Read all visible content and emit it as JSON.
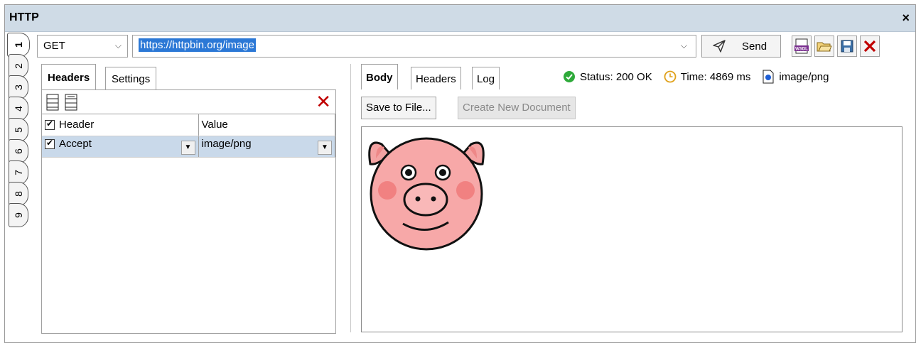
{
  "window": {
    "title": "HTTP",
    "close_label": "×"
  },
  "vertical_tabs": [
    "1",
    "2",
    "3",
    "4",
    "5",
    "6",
    "7",
    "8",
    "9"
  ],
  "request": {
    "method": "GET",
    "url": "https://httpbin.org/image",
    "send_label": "Send"
  },
  "left": {
    "tabs": [
      "Headers",
      "Settings"
    ],
    "table": {
      "columns": [
        "Header",
        "Value"
      ],
      "rows": [
        {
          "header": "Accept",
          "value": "image/png"
        }
      ]
    }
  },
  "right": {
    "tabs": [
      "Body",
      "Headers",
      "Log"
    ],
    "status": "Status: 200 OK",
    "time": "Time: 4869 ms",
    "content_type": "image/png",
    "save_label": "Save to File...",
    "create_label": "Create New Document"
  },
  "colors": {
    "accent": "#2b78d6",
    "titlebar": "#cfdbe6",
    "status_ok": "#2eaa3a",
    "delete": "#c00000"
  },
  "icons": {
    "send": "paper-plane-icon",
    "toolbar": [
      "wsdl-icon",
      "open-folder-icon",
      "save-icon",
      "close-red-icon"
    ],
    "status_ok": "check-circle-icon",
    "time": "clock-icon",
    "content_type": "file-icon"
  }
}
